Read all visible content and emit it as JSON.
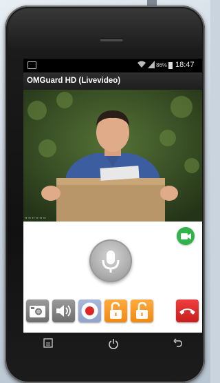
{
  "status_bar": {
    "battery_percent": "86%",
    "time": "18:47",
    "wifi_icon": "wifi-icon",
    "signal_icon": "signal-icon",
    "notification_icon": "notification-icon"
  },
  "app": {
    "title": "OMGuard HD (Livevideo)"
  },
  "video": {
    "overlay_stamp": "▪▪ ▪▪ ▪▪ ▪▪ ▪▪ ▪▪",
    "description_icon": "live-video-feed"
  },
  "controls": {
    "video_toggle_icon": "video-camera-icon",
    "microphone_icon": "microphone-icon",
    "toolbar": [
      {
        "name": "snapshot-button",
        "icon": "camera-icon",
        "color": "#8a8a8a"
      },
      {
        "name": "speaker-button",
        "icon": "speaker-icon",
        "color": "#8a8a8a"
      },
      {
        "name": "record-button",
        "icon": "record-icon",
        "color": "#9bb0d6"
      },
      {
        "name": "unlock-button-1",
        "icon": "unlock-icon",
        "color": "#f59a20"
      },
      {
        "name": "unlock-button-2",
        "icon": "unlock-icon",
        "color": "#f59a20"
      },
      {
        "name": "hangup-button",
        "icon": "hang-up-icon",
        "color": "#d92a2a"
      }
    ]
  },
  "navigation": {
    "menu_icon": "menu-icon",
    "power_icon": "power-icon",
    "back_icon": "back-icon"
  }
}
